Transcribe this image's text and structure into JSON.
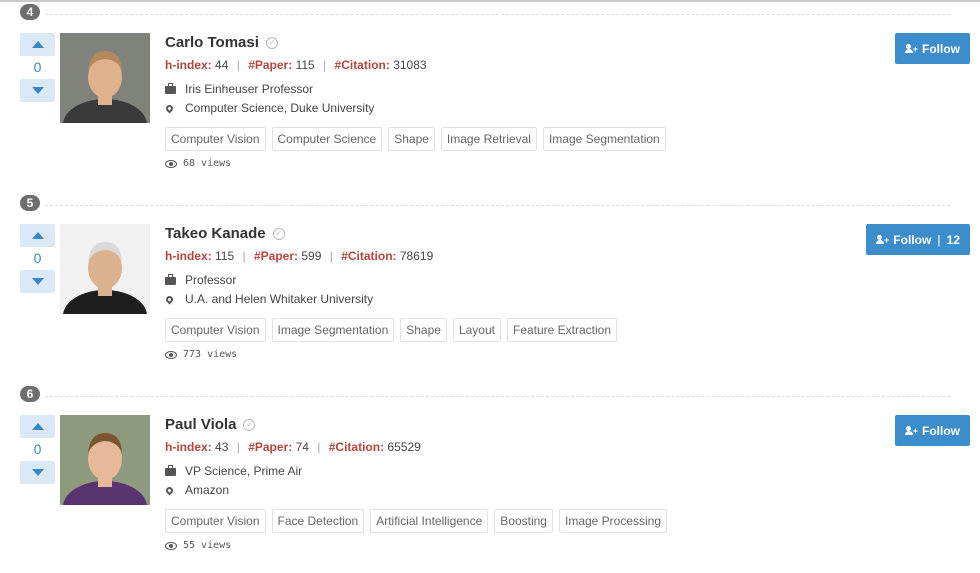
{
  "colors": {
    "accent": "#3c8dcc",
    "stat_label": "#b5463e",
    "rank_badge": "#6e6e6e",
    "vote_bg": "#dbe8f5"
  },
  "icons": {
    "verified": "check-circle-icon",
    "position": "briefcase-icon",
    "affiliation": "map-marker-icon",
    "views": "eye-icon",
    "follow": "user-plus-icon",
    "vote_up": "triangle-up-icon",
    "vote_down": "triangle-down-icon"
  },
  "scholars": [
    {
      "rank": "4",
      "votes": "0",
      "name": "Carlo Tomasi",
      "h_index_label": "h-index:",
      "h_index": "44",
      "paper_label": "#Paper:",
      "papers": "115",
      "citation_label": "#Citation:",
      "citations": "31083",
      "position": "Iris Einheuser Professor",
      "affiliation": "Computer Science, Duke University",
      "tags": [
        "Computer Vision",
        "Computer Science",
        "Shape",
        "Image Retrieval",
        "Image Segmentation"
      ],
      "views": "68 views",
      "follow_label": "Follow",
      "follow_count": ""
    },
    {
      "rank": "5",
      "votes": "0",
      "name": "Takeo Kanade",
      "h_index_label": "h-index:",
      "h_index": "115",
      "paper_label": "#Paper:",
      "papers": "599",
      "citation_label": "#Citation:",
      "citations": "78619",
      "position": "Professor",
      "affiliation": "U.A. and Helen Whitaker University",
      "tags": [
        "Computer Vision",
        "Image Segmentation",
        "Shape",
        "Layout",
        "Feature Extraction"
      ],
      "views": "773 views",
      "follow_label": "Follow",
      "follow_count": "12"
    },
    {
      "rank": "6",
      "votes": "0",
      "name": "Paul Viola",
      "h_index_label": "h-index:",
      "h_index": "43",
      "paper_label": "#Paper:",
      "papers": "74",
      "citation_label": "#Citation:",
      "citations": "65529",
      "position": "VP Science, Prime Air",
      "affiliation": "Amazon",
      "tags": [
        "Computer Vision",
        "Face Detection",
        "Artificial Intelligence",
        "Boosting",
        "Image Processing"
      ],
      "views": "55 views",
      "follow_label": "Follow",
      "follow_count": ""
    }
  ]
}
